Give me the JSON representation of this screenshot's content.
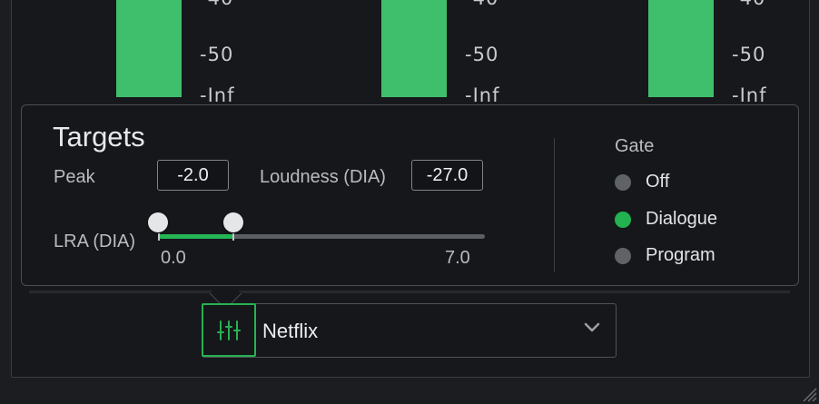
{
  "meters": {
    "scale": [
      "-40",
      "-50",
      "-Inf"
    ],
    "bar_color": "#3fbf6b"
  },
  "targets": {
    "title": "Targets",
    "peak_label": "Peak",
    "peak_value": "-2.0",
    "loudness_label": "Loudness (DIA)",
    "loudness_value": "-27.0",
    "lra_label": "LRA (DIA)",
    "lra_min": "0.0",
    "lra_max": "7.0"
  },
  "gate": {
    "title": "Gate",
    "options": [
      {
        "label": "Off",
        "selected": false
      },
      {
        "label": "Dialogue",
        "selected": true
      },
      {
        "label": "Program",
        "selected": false
      }
    ]
  },
  "preset": {
    "icon": "sliders-icon",
    "value": "Netflix",
    "dropdown_icon": "chevron-down-icon"
  },
  "colors": {
    "accent": "#22b24f",
    "background": "#16181b"
  }
}
